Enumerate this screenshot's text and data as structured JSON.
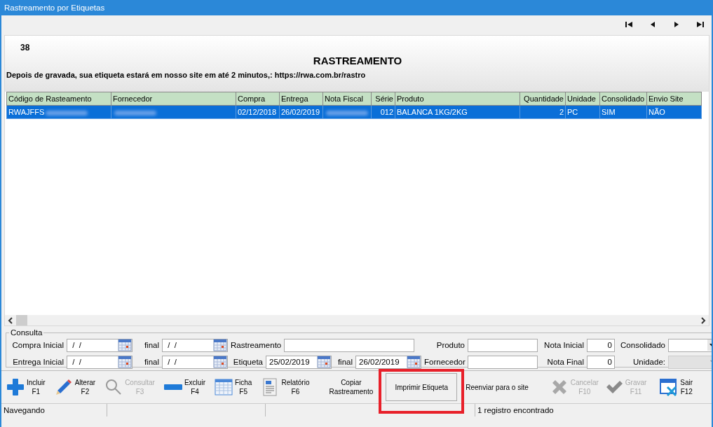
{
  "window": {
    "title": "Rastreamento por Etiquetas"
  },
  "navigator": [
    {
      "kind": "first"
    },
    {
      "kind": "prev"
    },
    {
      "kind": "next"
    },
    {
      "kind": "last"
    }
  ],
  "header": {
    "record": "38",
    "title": "RASTREAMENTO",
    "notice": "Depois de gravada, sua etiqueta estará em nosso site em até 2 minutos,: https://rwa.com.br/rastro"
  },
  "table": {
    "columns": [
      "Código de Rasteamento",
      "Fornecedor",
      "Compra",
      "Entrega",
      "Nota Fiscal",
      "Série",
      "Produto",
      "Quantidade",
      "Unidade",
      "Consolidado",
      "Envio Site"
    ],
    "rows": [
      {
        "selected": true,
        "cells": [
          {
            "text": "RWAJFFS",
            "blurred": true
          },
          {
            "blurred": true
          },
          {
            "text": "02/12/2018"
          },
          {
            "text": "26/02/2019"
          },
          {
            "blurred": true
          },
          {
            "text": "012"
          },
          {
            "text": "BALANCA 1KG/2KG"
          },
          {
            "text": "2"
          },
          {
            "text": "PC"
          },
          {
            "text": "SIM"
          },
          {
            "text": "NÃO"
          }
        ]
      }
    ]
  },
  "consulta": {
    "title": "Consulta",
    "lines": [
      {
        "fields": [
          {
            "label": "Compra Inicial",
            "kind": "date",
            "value": " /  /"
          },
          {
            "label": "final",
            "kind": "date",
            "value": " /  /"
          },
          {
            "label": "Rastreamento",
            "kind": "text"
          },
          {
            "label": "Produto",
            "kind": "text"
          },
          {
            "label": "Nota Inicial",
            "kind": "number",
            "value": "0"
          },
          {
            "label": "Consolidado",
            "kind": "combo",
            "disabled": false
          }
        ]
      },
      {
        "fields": [
          {
            "label": "Entrega Inicial",
            "kind": "date",
            "value": " /  /"
          },
          {
            "label": "final",
            "kind": "date",
            "value": " /  /"
          },
          {
            "label": "Etiqueta",
            "kind": "date",
            "value": "25/02/2019"
          },
          {
            "label": "final",
            "kind": "date",
            "value": "26/02/2019"
          },
          {
            "label": "Fornecedor",
            "kind": "text"
          },
          {
            "label": "Nota Final",
            "kind": "number",
            "value": "0"
          },
          {
            "label": "Unidade:",
            "kind": "combo",
            "disabled": true
          }
        ]
      }
    ]
  },
  "toolbar": [
    {
      "kind": "plus",
      "label": "Incluir",
      "key": "F1",
      "disabled": false
    },
    {
      "kind": "pencil",
      "label": "Alterar",
      "key": "F2",
      "disabled": false
    },
    {
      "kind": "search",
      "label": "Consultar",
      "key": "F3",
      "disabled": true
    },
    {
      "kind": "minus",
      "label": "Excluir",
      "key": "F4",
      "disabled": false
    },
    {
      "kind": "grid",
      "label": "Ficha",
      "key": "F5",
      "disabled": false
    },
    {
      "kind": "report",
      "label": "Relatório",
      "key": "F6",
      "disabled": false
    },
    {
      "kind": "text",
      "label": "Copiar",
      "key": "Rastreamento",
      "disabled": false
    },
    {
      "kind": "button",
      "label": "Imprimir Etiqueta",
      "highlighted": true,
      "disabled": false
    },
    {
      "kind": "link",
      "label": "Reenviar para o site",
      "disabled": false
    },
    {
      "kind": "cross",
      "label": "Cancelar",
      "key": "F10",
      "disabled": true
    },
    {
      "kind": "check",
      "label": "Gravar",
      "key": "F11",
      "disabled": true
    },
    {
      "kind": "exit",
      "label": "Sair",
      "key": "F12",
      "disabled": false
    }
  ],
  "status_bar": {
    "mode": "Navegando",
    "message": "1 registro encontrado"
  }
}
